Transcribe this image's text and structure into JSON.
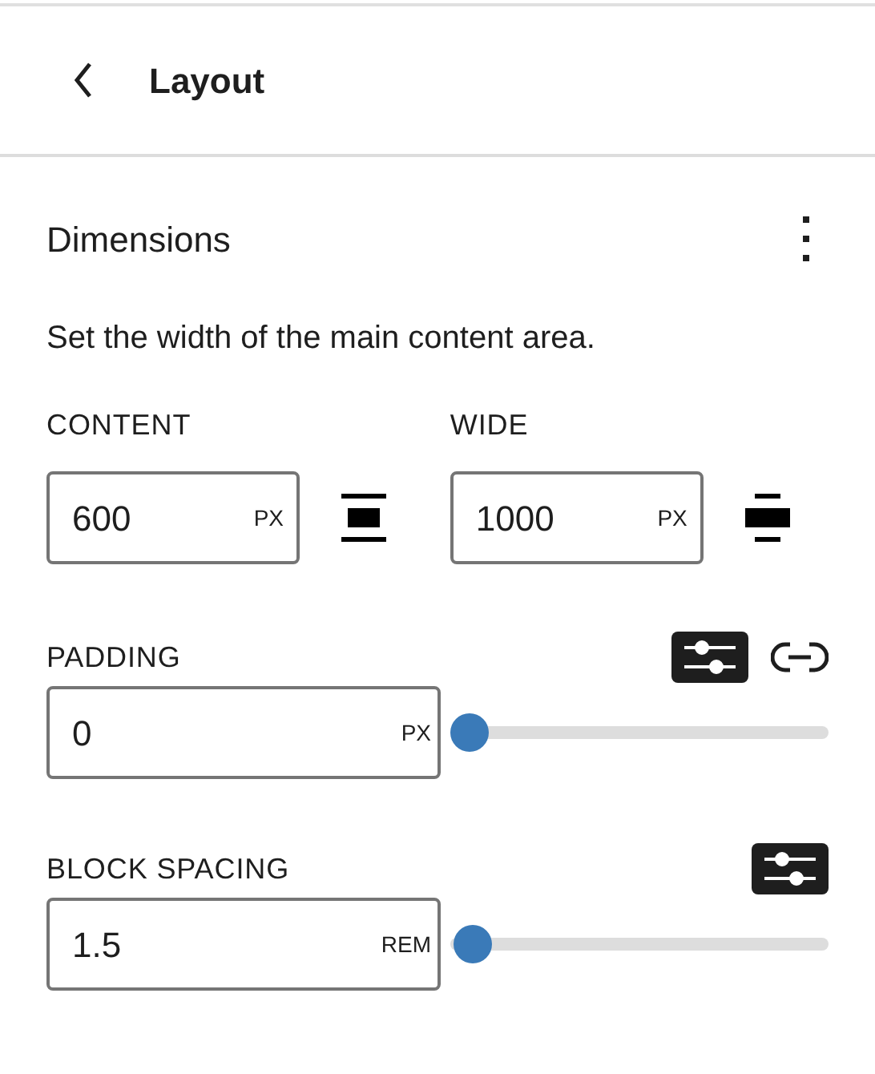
{
  "header": {
    "title": "Layout"
  },
  "panel": {
    "title": "Dimensions",
    "description": "Set the width of the main content area."
  },
  "widths": [
    {
      "label": "CONTENT",
      "value": "600",
      "unit": "PX",
      "kind": "content"
    },
    {
      "label": "WIDE",
      "value": "1000",
      "unit": "PX",
      "kind": "wide"
    }
  ],
  "spacing": [
    {
      "label": "PADDING",
      "value": "0",
      "unit": "PX",
      "level": 0,
      "custom_selected": true,
      "has_link": true
    },
    {
      "label": "BLOCK SPACING",
      "value": "1.5",
      "unit": "REM",
      "level": 0.01,
      "custom_selected": true,
      "has_link": false
    }
  ]
}
